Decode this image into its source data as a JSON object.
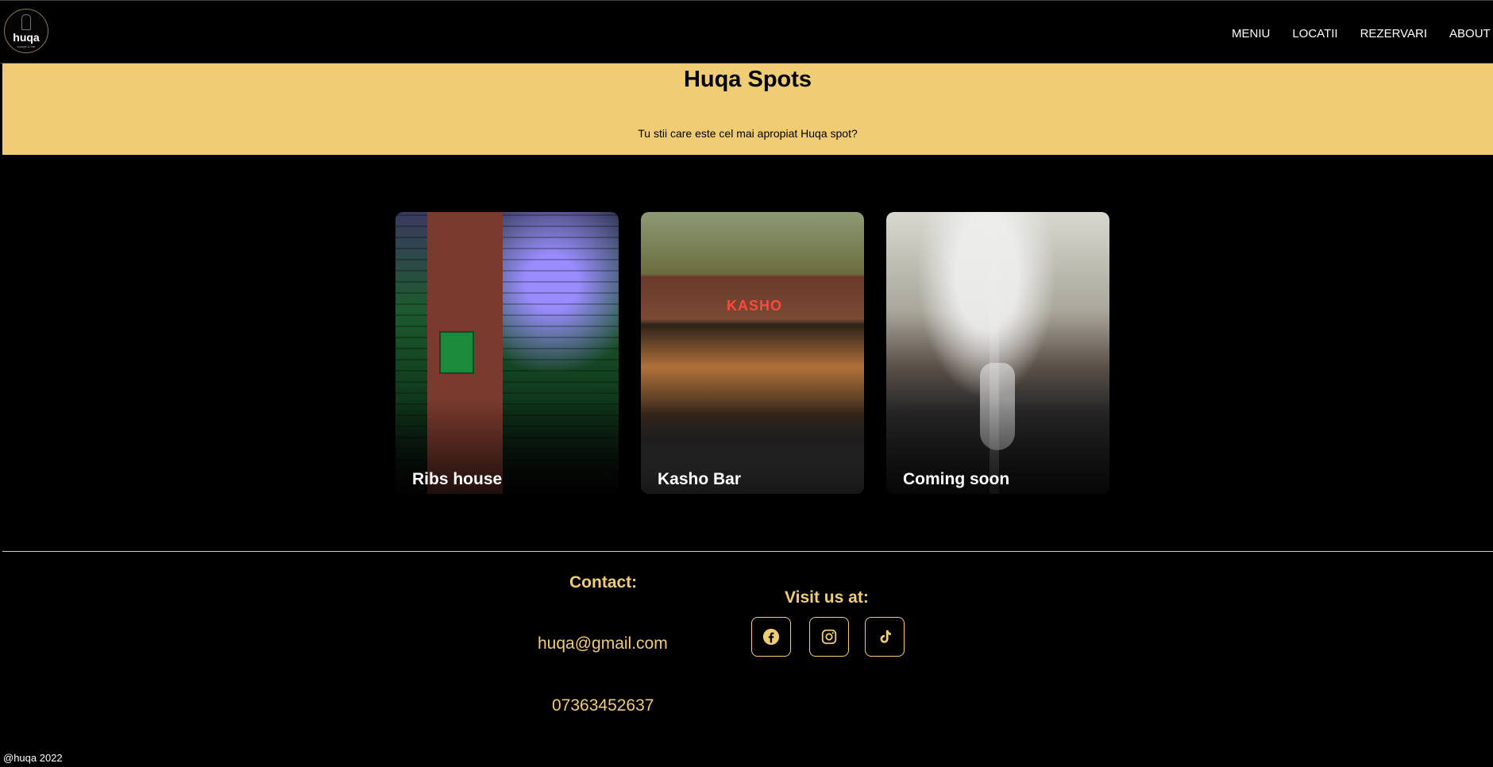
{
  "brand": {
    "logo_text": "huqa",
    "logo_subtitle": "lounge & bar"
  },
  "nav": {
    "items": [
      {
        "label": "MENIU"
      },
      {
        "label": "LOCATII"
      },
      {
        "label": "REZERVARI"
      },
      {
        "label": "ABOUT US"
      }
    ]
  },
  "hero": {
    "title": "Huqa Spots",
    "subtitle": "Tu stii care este cel mai apropiat Huqa spot?"
  },
  "cards": [
    {
      "label": "Ribs house"
    },
    {
      "label": "Kasho Bar"
    },
    {
      "label": "Coming soon"
    }
  ],
  "footer": {
    "contact_title": "Contact:",
    "email": "huqa@gmail.com",
    "phone": "07363452637",
    "visit_title": "Visit us at:",
    "social": [
      {
        "icon": "facebook-icon"
      },
      {
        "icon": "instagram-icon"
      },
      {
        "icon": "tiktok-icon"
      }
    ],
    "copyright": "@huqa 2022"
  },
  "colors": {
    "accent": "#f0cd75",
    "background": "#000000"
  }
}
